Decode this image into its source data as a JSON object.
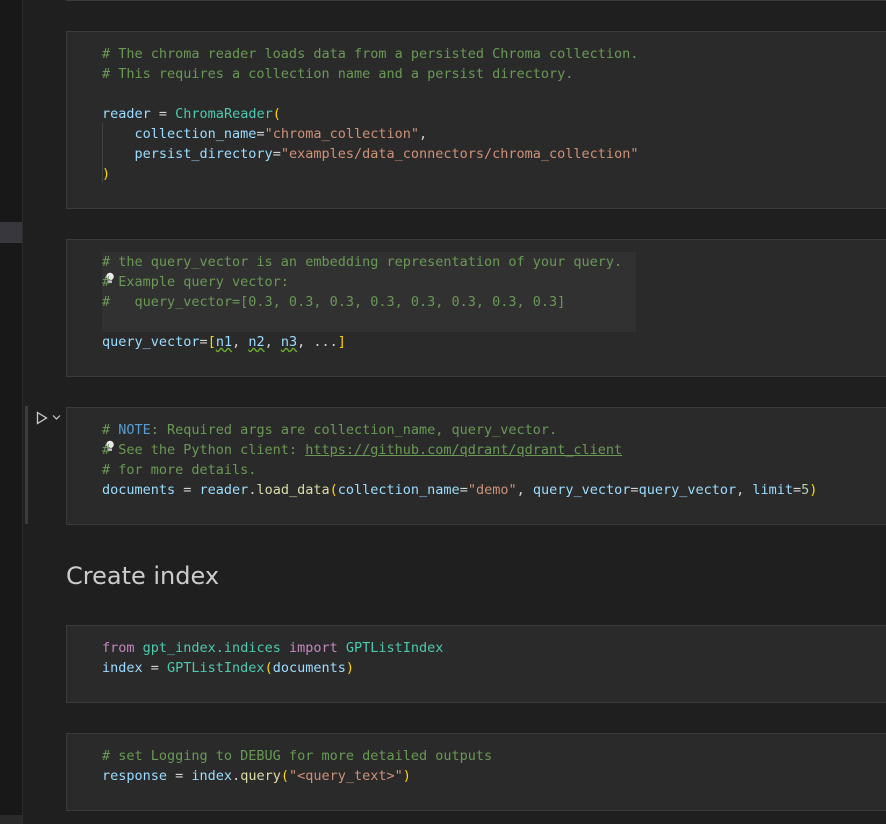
{
  "gutter": {
    "active_marker": ""
  },
  "cells": [
    {
      "lines": [
        [
          "# The chroma reader loads data from a persisted Chroma collection."
        ],
        [
          "# This requires a collection name and a persist directory."
        ],
        [
          ""
        ],
        [
          "reader",
          " = ",
          "ChromaReader",
          "("
        ],
        [
          "    ",
          "collection_name",
          "=",
          "\"chroma_collection\"",
          ","
        ],
        [
          "    ",
          "persist_directory",
          "=",
          "\"examples/data_connectors/chroma_collection\""
        ],
        [
          ")"
        ]
      ]
    },
    {
      "lines": [
        [
          "# the query_vector is an embedding representation of your query."
        ],
        [
          "# Example query vector:"
        ],
        [
          "#   query_vector=[0.3, 0.3, 0.3, 0.3, 0.3, 0.3, 0.3, 0.3]"
        ],
        [
          ""
        ],
        [
          "query_vector",
          "=",
          "[",
          "n1",
          ", ",
          "n2",
          ", ",
          "n3",
          ", ...",
          "]"
        ]
      ]
    },
    {
      "lines": [
        [
          "# ",
          "NOTE",
          ": Required args are collection_name, query_vector."
        ],
        [
          "# See the Python client: ",
          "https://github.com/qdrant/qdrant_client"
        ],
        [
          "# for more details."
        ],
        [
          "documents",
          " = ",
          "reader",
          ".",
          "load_data",
          "(",
          "collection_name",
          "=",
          "\"demo\"",
          ", ",
          "query_vector",
          "=",
          "query_vector",
          ", ",
          "limit",
          "=",
          "5",
          ")"
        ]
      ]
    },
    {
      "lines": [
        [
          "from",
          " ",
          "gpt_index.indices",
          " ",
          "import",
          " ",
          "GPTListIndex"
        ],
        [
          "index",
          " = ",
          "GPTListIndex",
          "(",
          "documents",
          ")"
        ]
      ]
    },
    {
      "lines": [
        [
          "# set Logging to DEBUG for more detailed outputs"
        ],
        [
          "response",
          " = ",
          "index",
          ".",
          "query",
          "(",
          "\"<query_text>\"",
          ")"
        ]
      ]
    }
  ],
  "markdown": {
    "heading": "Create index"
  },
  "icons": {
    "run": "play-icon",
    "expand": "chevron-down-icon",
    "lightbulb": "lightbulb-icon"
  }
}
